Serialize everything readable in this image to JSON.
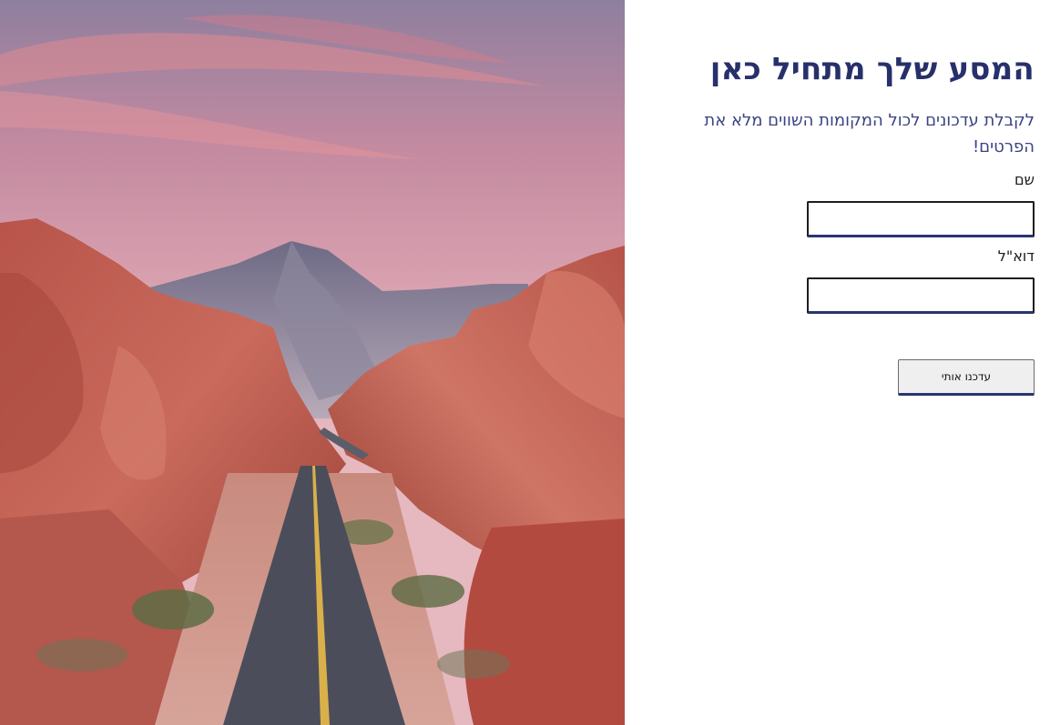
{
  "hero": {
    "image_name": "desert-road-landscape"
  },
  "form": {
    "title": "המסע שלך מתחיל כאן",
    "subtitle": "לקבלת עדכונים לכול המקומות השווים מלא את הפרטים!",
    "name_label": "שם",
    "name_value": "",
    "email_label": "דוא\"ל",
    "email_value": "",
    "submit_label": "עדכנו אותי"
  },
  "colors": {
    "accent": "#27306b",
    "subtitle": "#3a4383",
    "button_bg": "#efefef"
  }
}
